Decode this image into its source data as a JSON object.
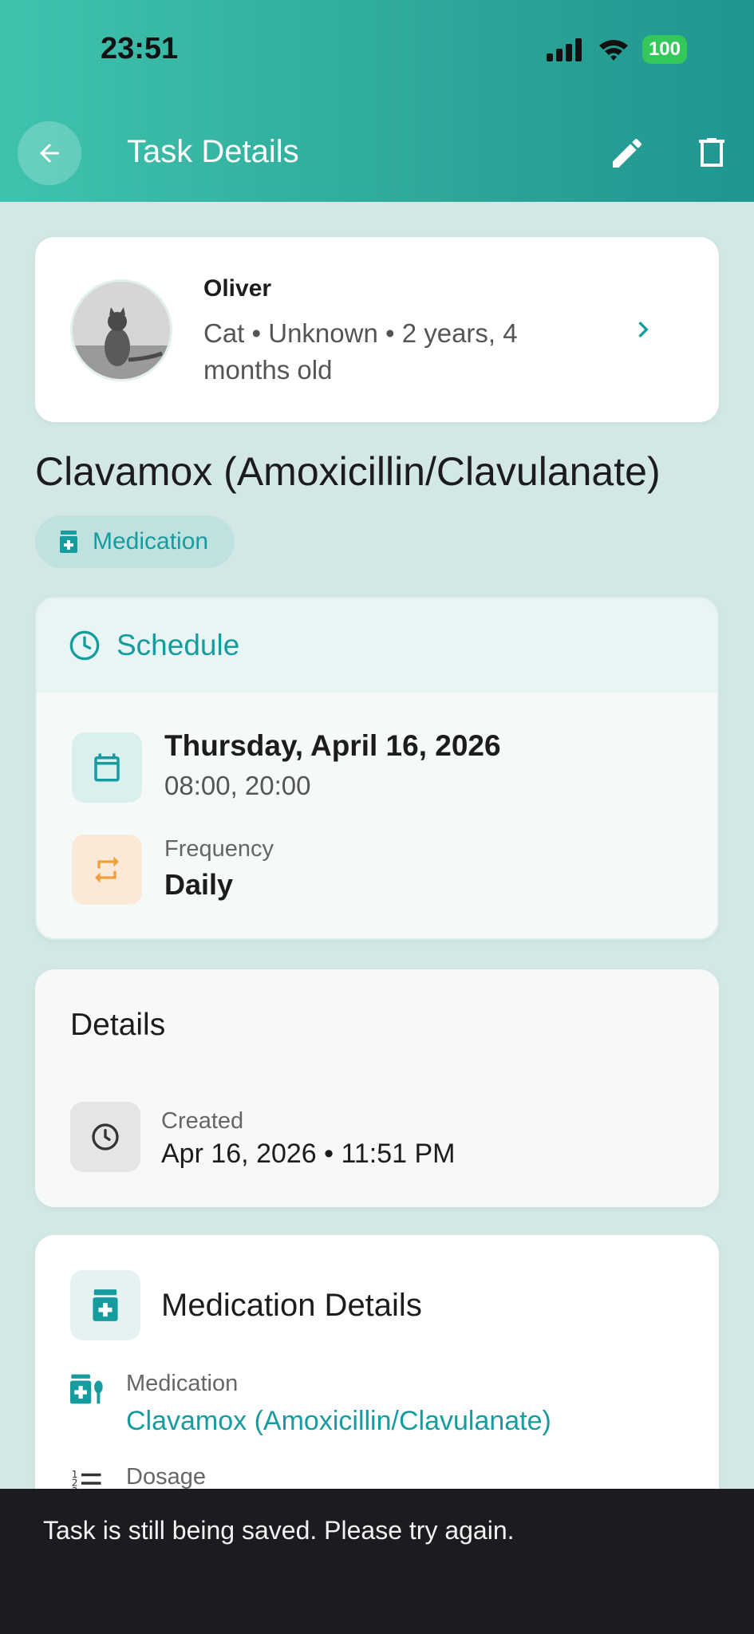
{
  "status_bar": {
    "time": "23:51",
    "battery": "100"
  },
  "header": {
    "title": "Task Details"
  },
  "pet": {
    "name": "Oliver",
    "meta": "Cat • Unknown • 2 years, 4 months old"
  },
  "task": {
    "title": "Clavamox (Amoxicillin/Clavulanate)",
    "type": "Medication"
  },
  "schedule": {
    "heading": "Schedule",
    "date": "Thursday, April 16, 2026",
    "times": "08:00, 20:00",
    "frequency_label": "Frequency",
    "frequency_value": "Daily"
  },
  "details": {
    "heading": "Details",
    "created_label": "Created",
    "created_value": "Apr 16, 2026 • 11:51 PM"
  },
  "medication_details": {
    "heading": "Medication Details",
    "medication_label": "Medication",
    "medication_value": "Clavamox (Amoxicillin/Clavulanate)",
    "dosage_label": "Dosage"
  },
  "snackbar": {
    "message": "Task is still being saved. Please try again."
  },
  "colors": {
    "accent": "#169c9f",
    "header": "#2ea99a",
    "orange": "#f0a03a"
  },
  "icons": [
    "back-arrow-icon",
    "edit-pencil-icon",
    "trash-icon",
    "chevron-right-icon",
    "medication-icon",
    "clock-icon",
    "calendar-icon",
    "repeat-icon",
    "dosage-list-icon"
  ]
}
